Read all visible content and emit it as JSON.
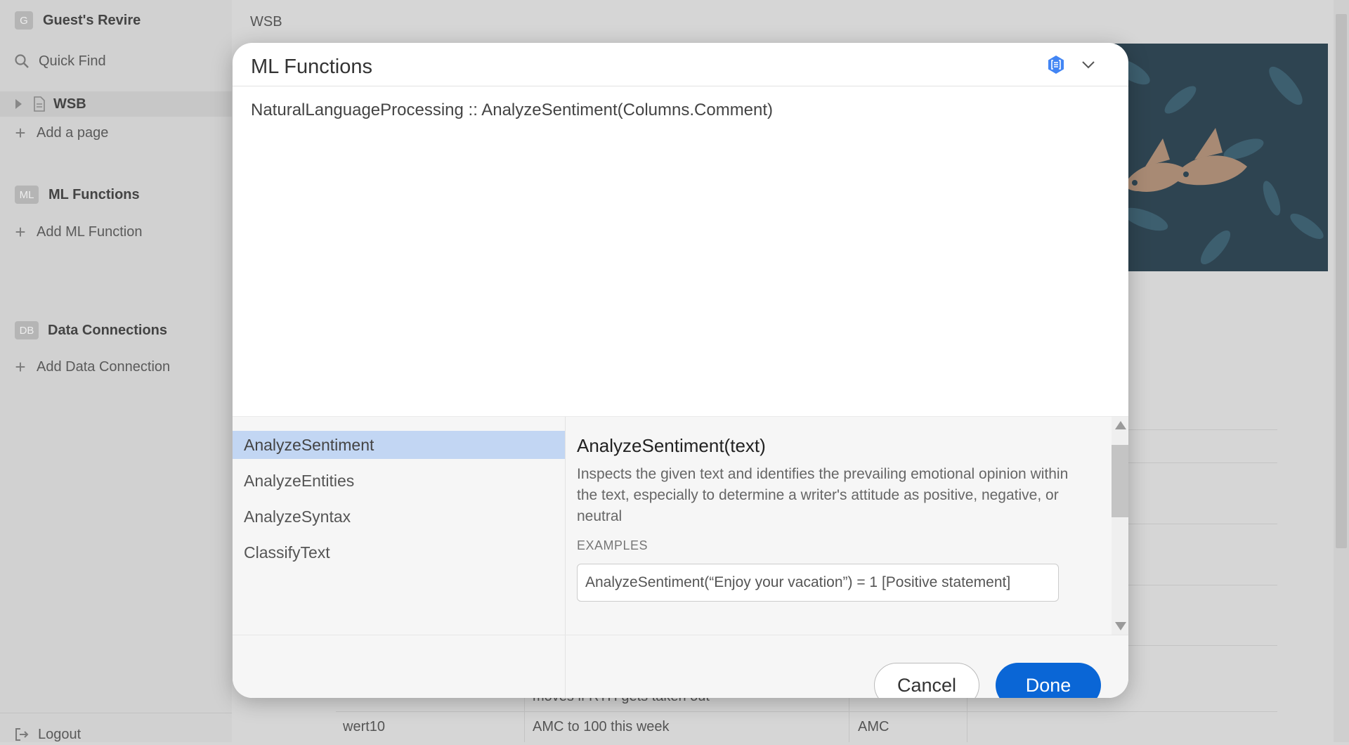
{
  "sidebar": {
    "workspace": {
      "badge": "G",
      "name": "Guest's Revire"
    },
    "quick_find": "Quick Find",
    "page": "WSB",
    "add_page": "Add a page",
    "ml_section": {
      "badge": "ML",
      "title": "ML Functions"
    },
    "add_ml": "Add ML Function",
    "data_section": {
      "badge": "DB",
      "title": "Data Connections"
    },
    "add_data": "Add Data Connection",
    "logout": "Logout"
  },
  "main": {
    "breadcrumb": "WSB",
    "table_rows": [
      {
        "col1": "",
        "col2": "moves if RTH gets taken out",
        "col3": ""
      },
      {
        "col1": "wert10",
        "col2": "AMC to 100 this week",
        "col3": "AMC"
      }
    ]
  },
  "modal": {
    "title": "ML Functions",
    "icon": "cloud-nl-icon",
    "expression": "NaturalLanguageProcessing :: AnalyzeSentiment(Columns.Comment)",
    "functions": [
      "AnalyzeSentiment",
      "AnalyzeEntities",
      "AnalyzeSyntax",
      "ClassifyText"
    ],
    "selected_index": 0,
    "doc": {
      "title": "AnalyzeSentiment(text)",
      "description": "Inspects the given text and identifies the prevailing emotional opinion within the text, especially to determine a writer's attitude as positive, negative, or neutral",
      "examples_label": "EXAMPLES",
      "example": "AnalyzeSentiment(“Enjoy your vacation”) = 1 [Positive statement]"
    },
    "cancel_label": "Cancel",
    "done_label": "Done",
    "colors": {
      "accent": "#0a66d6",
      "selection": "#c2d6f3",
      "icon": "#4285f4"
    }
  }
}
